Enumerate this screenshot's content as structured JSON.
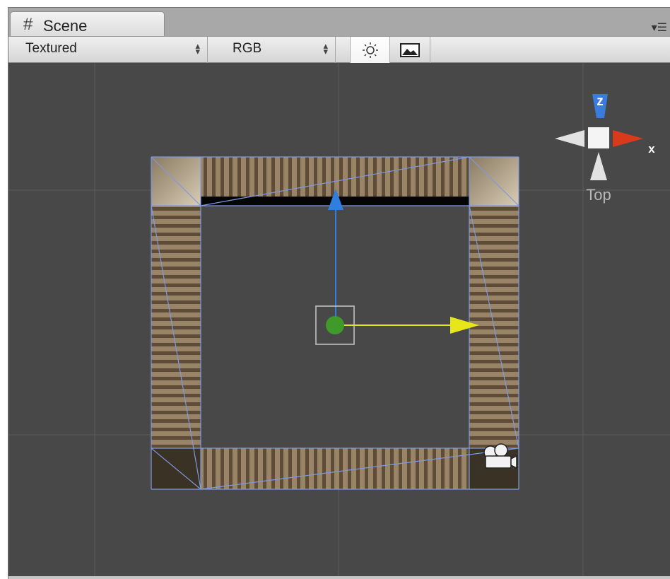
{
  "tab": {
    "icon": "scene-grid-icon",
    "label": "Scene"
  },
  "toolbar": {
    "render_mode": "Textured",
    "color_mode": "RGB",
    "lighting_icon": "sun-icon",
    "image_icon": "image-icon"
  },
  "gizmo": {
    "z_label": "z",
    "x_label": "x",
    "view_label": "Top"
  },
  "colors": {
    "viewport_bg": "#484848",
    "z_axis": "#3a7bdc",
    "x_axis": "#d93a1c",
    "move_x": "#e6e61a",
    "move_z": "#2f7fe0",
    "pivot": "#3f9a2a"
  }
}
